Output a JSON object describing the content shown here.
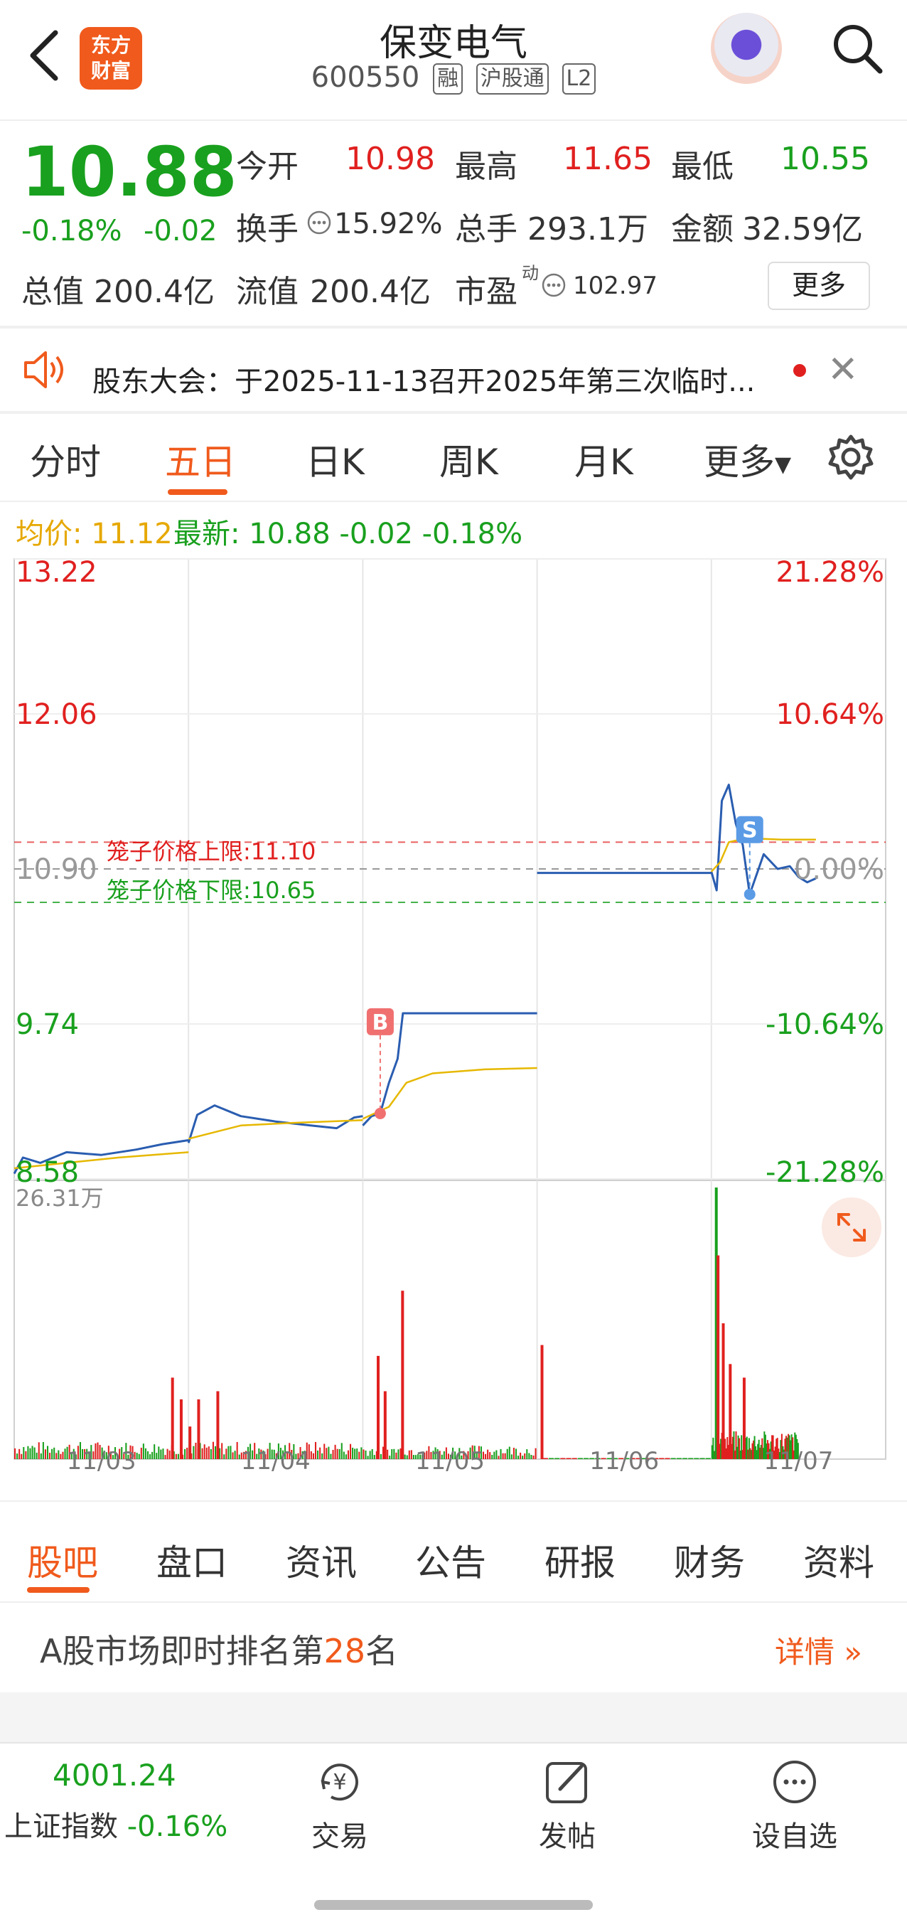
{
  "header": {
    "logo_line1": "东方",
    "logo_line2": "财富",
    "title": "保变电气",
    "code": "600550",
    "tags": [
      "融",
      "沪股通",
      "L2"
    ]
  },
  "quote": {
    "price": "10.88",
    "change_pct": "-0.18%",
    "change": "-0.02",
    "fields": [
      {
        "label": "今开",
        "value": "10.98",
        "color": "red"
      },
      {
        "label": "最高",
        "value": "11.65",
        "color": "red"
      },
      {
        "label": "最低",
        "value": "10.55",
        "color": "green"
      },
      {
        "label": "换手",
        "value": "15.92%",
        "color": "dark"
      },
      {
        "label": "总手",
        "value": "293.1万",
        "color": "dark"
      },
      {
        "label": "金额",
        "value": "32.59亿",
        "color": "dark"
      },
      {
        "label": "总值",
        "value": "200.4亿",
        "color": "dark"
      },
      {
        "label": "流值",
        "value": "200.4亿",
        "color": "dark"
      },
      {
        "label": "市盈",
        "value": "102.97",
        "color": "dark"
      }
    ],
    "pe_superscript": "动",
    "more_label": "更多"
  },
  "notice": {
    "text": "股东大会：于2025-11-13召开2025年第三次临时..."
  },
  "chart_tabs": [
    "分时",
    "五日",
    "日K",
    "周K",
    "月K",
    "更多"
  ],
  "active_chart_tab": 1,
  "legend": {
    "avg_label": "均价: 11.12",
    "latest_label": "最新: 10.88 -0.02 -0.18%"
  },
  "chart_data": {
    "type": "line",
    "title": "",
    "x_labels": [
      "11/03",
      "11/04",
      "11/05",
      "11/06",
      "11/07"
    ],
    "y_left_ticks": [
      "13.22",
      "12.06",
      "10.90",
      "9.74",
      "8.58"
    ],
    "y_right_ticks": [
      "21.28%",
      "10.64%",
      "0.00%",
      "-10.64%",
      "-21.28%"
    ],
    "ylim": [
      8.58,
      13.22
    ],
    "prev_close": 10.9,
    "upper_limit": {
      "label": "笼子价格上限:11.10",
      "value": 11.1
    },
    "lower_limit": {
      "label": "笼子价格下限:10.65",
      "value": 10.65
    },
    "markers": [
      {
        "label": "B",
        "day": 2,
        "t": 0.1,
        "value": 9.07
      },
      {
        "label": "S",
        "day": 4,
        "t": 0.22,
        "value": 10.71
      }
    ],
    "series": [
      {
        "name": "最新",
        "color": "#2a5db0",
        "days": [
          [
            [
              0,
              8.62
            ],
            [
              0.05,
              8.74
            ],
            [
              0.15,
              8.7
            ],
            [
              0.3,
              8.78
            ],
            [
              0.5,
              8.76
            ],
            [
              0.7,
              8.8
            ],
            [
              0.85,
              8.84
            ],
            [
              1.0,
              8.87
            ]
          ],
          [
            [
              0,
              8.85
            ],
            [
              0.05,
              9.06
            ],
            [
              0.15,
              9.13
            ],
            [
              0.3,
              9.05
            ],
            [
              0.5,
              9.01
            ],
            [
              0.7,
              8.98
            ],
            [
              0.85,
              8.96
            ],
            [
              0.95,
              9.04
            ],
            [
              1.0,
              9.05
            ]
          ],
          [
            [
              0,
              8.98
            ],
            [
              0.05,
              9.05
            ],
            [
              0.1,
              9.07
            ],
            [
              0.15,
              9.3
            ],
            [
              0.2,
              9.48
            ],
            [
              0.23,
              9.82
            ],
            [
              0.3,
              9.82
            ],
            [
              0.5,
              9.82
            ],
            [
              0.8,
              9.82
            ],
            [
              1.0,
              9.82
            ]
          ],
          [
            [
              0,
              10.87
            ],
            [
              0.3,
              10.87
            ],
            [
              0.6,
              10.87
            ],
            [
              0.9,
              10.87
            ],
            [
              1.0,
              10.87
            ]
          ],
          [
            [
              0,
              10.88
            ],
            [
              0.03,
              10.74
            ],
            [
              0.06,
              11.41
            ],
            [
              0.1,
              11.53
            ],
            [
              0.14,
              11.24
            ],
            [
              0.18,
              11.08
            ],
            [
              0.22,
              10.71
            ],
            [
              0.3,
              11.01
            ],
            [
              0.38,
              10.9
            ],
            [
              0.45,
              10.92
            ],
            [
              0.5,
              10.84
            ],
            [
              0.55,
              10.8
            ],
            [
              0.6,
              10.83
            ]
          ]
        ]
      },
      {
        "name": "均价",
        "color": "#e6b800",
        "days": [
          [
            [
              0,
              8.66
            ],
            [
              0.3,
              8.7
            ],
            [
              0.6,
              8.74
            ],
            [
              1.0,
              8.78
            ]
          ],
          [
            [
              0,
              8.88
            ],
            [
              0.3,
              8.98
            ],
            [
              0.6,
              9.0
            ],
            [
              1.0,
              9.02
            ]
          ],
          [
            [
              0,
              9.03
            ],
            [
              0.15,
              9.12
            ],
            [
              0.25,
              9.3
            ],
            [
              0.4,
              9.37
            ],
            [
              0.7,
              9.4
            ],
            [
              1.0,
              9.41
            ]
          ],
          [],
          [
            [
              0,
              10.88
            ],
            [
              0.05,
              10.95
            ],
            [
              0.1,
              11.1
            ],
            [
              0.2,
              11.13
            ],
            [
              0.4,
              11.12
            ],
            [
              0.6,
              11.12
            ]
          ]
        ]
      }
    ],
    "volume": {
      "max_label": "26.31万",
      "max": 263100
    }
  },
  "bottom_tabs": [
    "股吧",
    "盘口",
    "资讯",
    "公告",
    "研报",
    "财务",
    "资料"
  ],
  "active_bottom_tab": 0,
  "ranking": {
    "prefix": "A股市场即时排名第",
    "rank": "28",
    "suffix": "名",
    "detail_label": "详情"
  },
  "bottom_bar": {
    "index_value": "4001.24",
    "index_name": "上证指数",
    "index_change": "-0.16%",
    "trade_label": "交易",
    "post_label": "发帖",
    "watchlist_label": "设自选"
  },
  "colors": {
    "up": "#e0201f",
    "down": "#19a01e",
    "accent": "#f05a1c",
    "price_line": "#2a5db0",
    "avg_line": "#e6b800"
  }
}
